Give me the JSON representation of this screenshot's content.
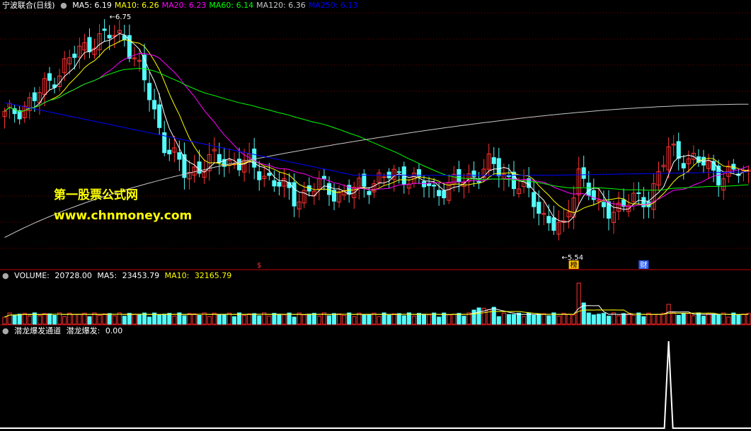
{
  "header": {
    "stock_title": "宁波联合(日线)",
    "ma_labels": [
      {
        "name": "MA5",
        "value": "6.19",
        "color": "#ffffff"
      },
      {
        "name": "MA10",
        "value": "6.26",
        "color": "#ffff00"
      },
      {
        "name": "MA20",
        "value": "6.23",
        "color": "#ff00ff"
      },
      {
        "name": "MA60",
        "value": "6.14",
        "color": "#00ff00"
      },
      {
        "name": "MA120",
        "value": "6.36",
        "color": "#c8c8c8"
      },
      {
        "name": "MA250",
        "value": "6.13",
        "color": "#0000ff"
      }
    ]
  },
  "watermark": {
    "line1": "第一股票公式网",
    "line2": "www.chnmoney.com"
  },
  "price_annotations": {
    "high_label": "6.75",
    "low_label": "5.54"
  },
  "event_markers": [
    {
      "text": "$",
      "color": "#ff3030"
    },
    {
      "text": "榜",
      "color": "#000000",
      "bg": "#ffc000"
    },
    {
      "text": "财",
      "color": "#ffffff",
      "bg": "#3060ff"
    }
  ],
  "volume_panel": {
    "title": "VOLUME",
    "value": "20728.00",
    "ma5_label": "MA5",
    "ma5_value": "23453.79",
    "ma10_label": "MA10",
    "ma10_value": "32165.79"
  },
  "indicator_panel": {
    "name": "潜龙爆发通道",
    "series_label": "潜龙爆发",
    "value": "0.00"
  },
  "colors": {
    "up": "#ff3232",
    "down": "#54fcfc",
    "grid": "#7a0000",
    "divider": "#c00000"
  },
  "chart_data": [
    {
      "type": "candlestick",
      "title": "宁波联合(日线)",
      "ylim": [
        5.4,
        6.8
      ],
      "annotations": [
        "6.75",
        "5.54"
      ],
      "series_legend": [
        "MA5",
        "MA10",
        "MA20",
        "MA60",
        "MA120",
        "MA250"
      ]
    },
    {
      "type": "bar",
      "title": "VOLUME",
      "legend": [
        "MA5",
        "MA10"
      ],
      "values_summary": {
        "VOLUME": 20728.0,
        "MA5": 23453.79,
        "MA10": 32165.79
      }
    },
    {
      "type": "line",
      "title": "潜龙爆发通道",
      "series": [
        {
          "name": "潜龙爆发",
          "last_value": 0.0
        }
      ]
    }
  ]
}
